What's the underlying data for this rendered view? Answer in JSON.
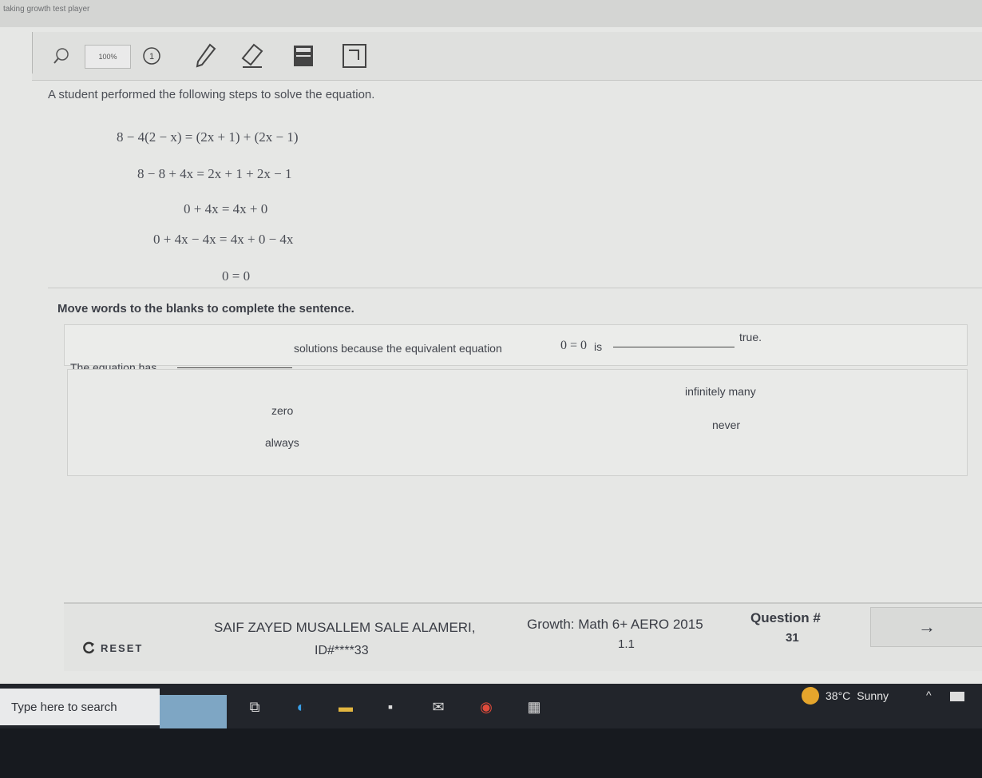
{
  "browser": {
    "tab_text": "taking growth  test player"
  },
  "toolbar": {
    "zoom": "100%",
    "number_tool": "1"
  },
  "question": {
    "prompt": "A student performed the following steps to solve the equation.",
    "steps": [
      "8 − 4(2 − x) = (2x + 1) + (2x − 1)",
      "8 − 8 + 4x = 2x + 1 + 2x − 1",
      "0 + 4x = 4x + 0",
      "0 + 4x − 4x = 4x + 0 − 4x",
      "0 = 0"
    ],
    "instruction": "Move words to the blanks to complete the sentence.",
    "sentence": {
      "part1": "The equation has",
      "part2": "solutions because the equivalent equation",
      "equation": "0 = 0",
      "is": "is",
      "part3": "true."
    },
    "word_bank": [
      "zero",
      "always",
      "infinitely many",
      "never"
    ]
  },
  "footer": {
    "reset_label": "RESET",
    "student_name": "SAIF ZAYED MUSALLEM SALE ALAMERI,",
    "student_id": "ID#****33",
    "test_name": "Growth: Math 6+ AERO 2015",
    "test_version": "1.1",
    "question_label": "Question #",
    "question_number": "31",
    "next_icon": "arrow-right-icon"
  },
  "taskbar": {
    "search_placeholder": "Type here to search",
    "temperature": "38°C",
    "weather": "Sunny"
  },
  "colors": {
    "background": "#e6e7e5",
    "text": "#3a3d45",
    "taskbar": "#22252b",
    "sun": "#e5a52c"
  }
}
